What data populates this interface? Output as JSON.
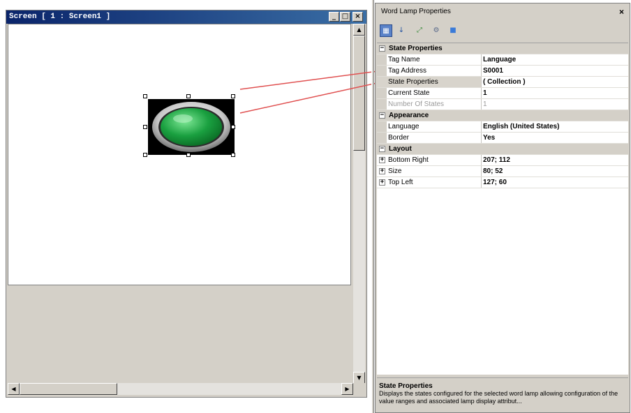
{
  "screen_window": {
    "title": "Screen [ 1 : Screen1 ]",
    "buttons": {
      "minimize": "_",
      "maximize": "□",
      "close": "×"
    }
  },
  "props_panel": {
    "title": "Word Lamp Properties",
    "close_label": "×",
    "toolbar": [
      {
        "name": "categorized-icon",
        "glyph": "▦"
      },
      {
        "name": "alphabetical-icon",
        "glyph": "↓"
      },
      {
        "name": "expand-icon",
        "glyph": "⤢"
      },
      {
        "name": "property-pages-icon",
        "glyph": "⚙"
      },
      {
        "name": "events-icon",
        "glyph": "■"
      }
    ],
    "categories": [
      {
        "label": "State Properties",
        "expander": "−",
        "rows": [
          {
            "name": "Tag Name",
            "value": "Language"
          },
          {
            "name": "Tag Address",
            "value": "S0001"
          },
          {
            "name": "State Properties",
            "value": "( Collection )",
            "selected": true
          },
          {
            "name": "Current State",
            "value": "1"
          },
          {
            "name": "Number Of States",
            "value": "1",
            "disabled": true
          }
        ]
      },
      {
        "label": "Appearance",
        "expander": "−",
        "rows": [
          {
            "name": "Language",
            "value": "English (United States)"
          },
          {
            "name": "Border",
            "value": "Yes"
          }
        ]
      },
      {
        "label": "Layout",
        "expander": "−",
        "rows": [
          {
            "name": "Bottom Right",
            "value": "207; 112",
            "expandable": true
          },
          {
            "name": "Size",
            "value": "80; 52",
            "expandable": true
          },
          {
            "name": "Top Left",
            "value": "127; 60",
            "expandable": true
          }
        ]
      }
    ],
    "description": {
      "title": "State Properties",
      "text": "Displays the states configured for the selected word lamp allowing configuration of the value ranges and associated lamp display attribut..."
    }
  },
  "colors": {
    "titlebar": "#0a246a",
    "lamp_green": "#1aa040",
    "callout_red": "#e05050"
  }
}
